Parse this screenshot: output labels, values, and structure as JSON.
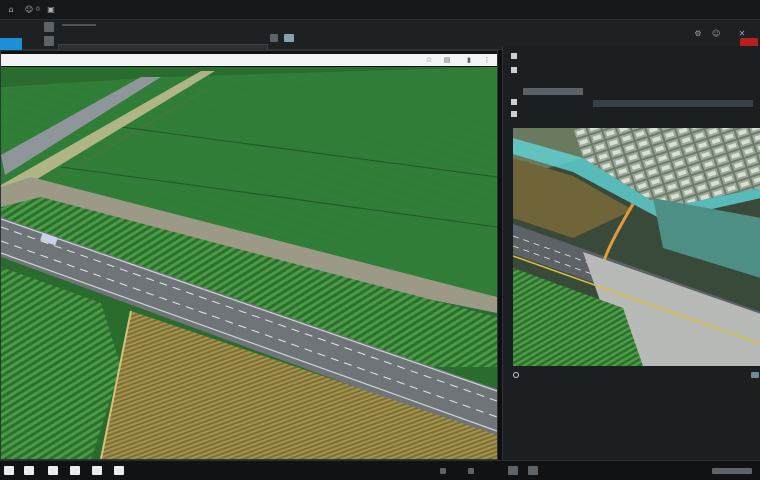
{
  "topbar": {
    "icons": [
      "home-icon",
      "user-icon",
      "file-icon"
    ],
    "page_label": "0"
  },
  "toolbar": {
    "primary_button": "",
    "right_icons": [
      "settings-icon",
      "user-icon",
      "close-icon"
    ]
  },
  "viewport": {
    "address_text": "",
    "url_icons": [
      "star-icon",
      "clipboard-icon",
      "bookmark-icon",
      "more-icon"
    ],
    "scene": "aerial-road-farmland"
  },
  "panel": {
    "title": "",
    "subtitle": "",
    "row3": "",
    "row4": "",
    "status": "",
    "scene": "aerial-interchange-view"
  },
  "taskbar": {
    "left_icons": [
      "app-1",
      "app-2",
      "app-3",
      "app-4",
      "app-5",
      "app-6",
      "app-7"
    ],
    "right_label": ""
  },
  "colors": {
    "accent": "#1d8fd6",
    "field_green": "#2f7a3a",
    "wheat": "#8a7b3c",
    "road": "#7d8286",
    "badge": "#b81f1f"
  }
}
